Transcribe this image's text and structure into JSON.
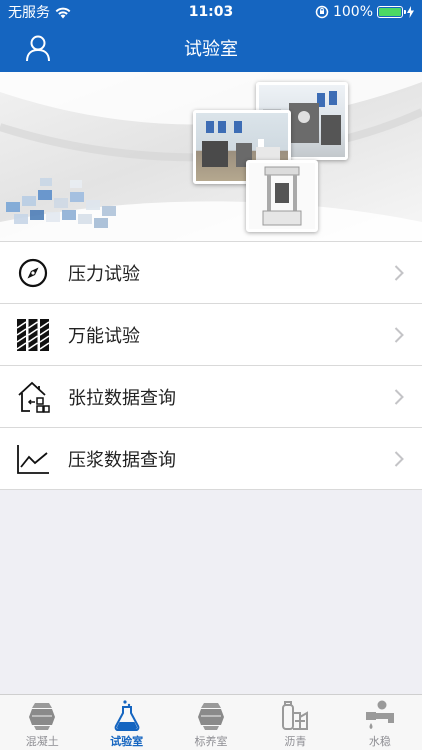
{
  "status_bar": {
    "carrier": "无服务",
    "time": "11:03",
    "battery_percent": "100%",
    "battery_level": 1.0
  },
  "nav": {
    "title": "试验室",
    "user_icon": "user-icon"
  },
  "colors": {
    "primary": "#1565c0",
    "tab_inactive": "#8e8e93",
    "background": "#efeff4"
  },
  "menu": {
    "items": [
      {
        "label": "压力试验",
        "icon": "compass-icon"
      },
      {
        "label": "万能试验",
        "icon": "drill-bits-icon"
      },
      {
        "label": "张拉数据查询",
        "icon": "house-data-icon"
      },
      {
        "label": "压浆数据查询",
        "icon": "line-chart-icon"
      }
    ]
  },
  "tabs": {
    "items": [
      {
        "label": "混凝土",
        "icon": "concrete-icon",
        "active": false
      },
      {
        "label": "试验室",
        "icon": "flask-icon",
        "active": true
      },
      {
        "label": "标养室",
        "icon": "curing-room-icon",
        "active": false
      },
      {
        "label": "沥青",
        "icon": "asphalt-icon",
        "active": false
      },
      {
        "label": "水稳",
        "icon": "water-stability-icon",
        "active": false
      }
    ]
  }
}
